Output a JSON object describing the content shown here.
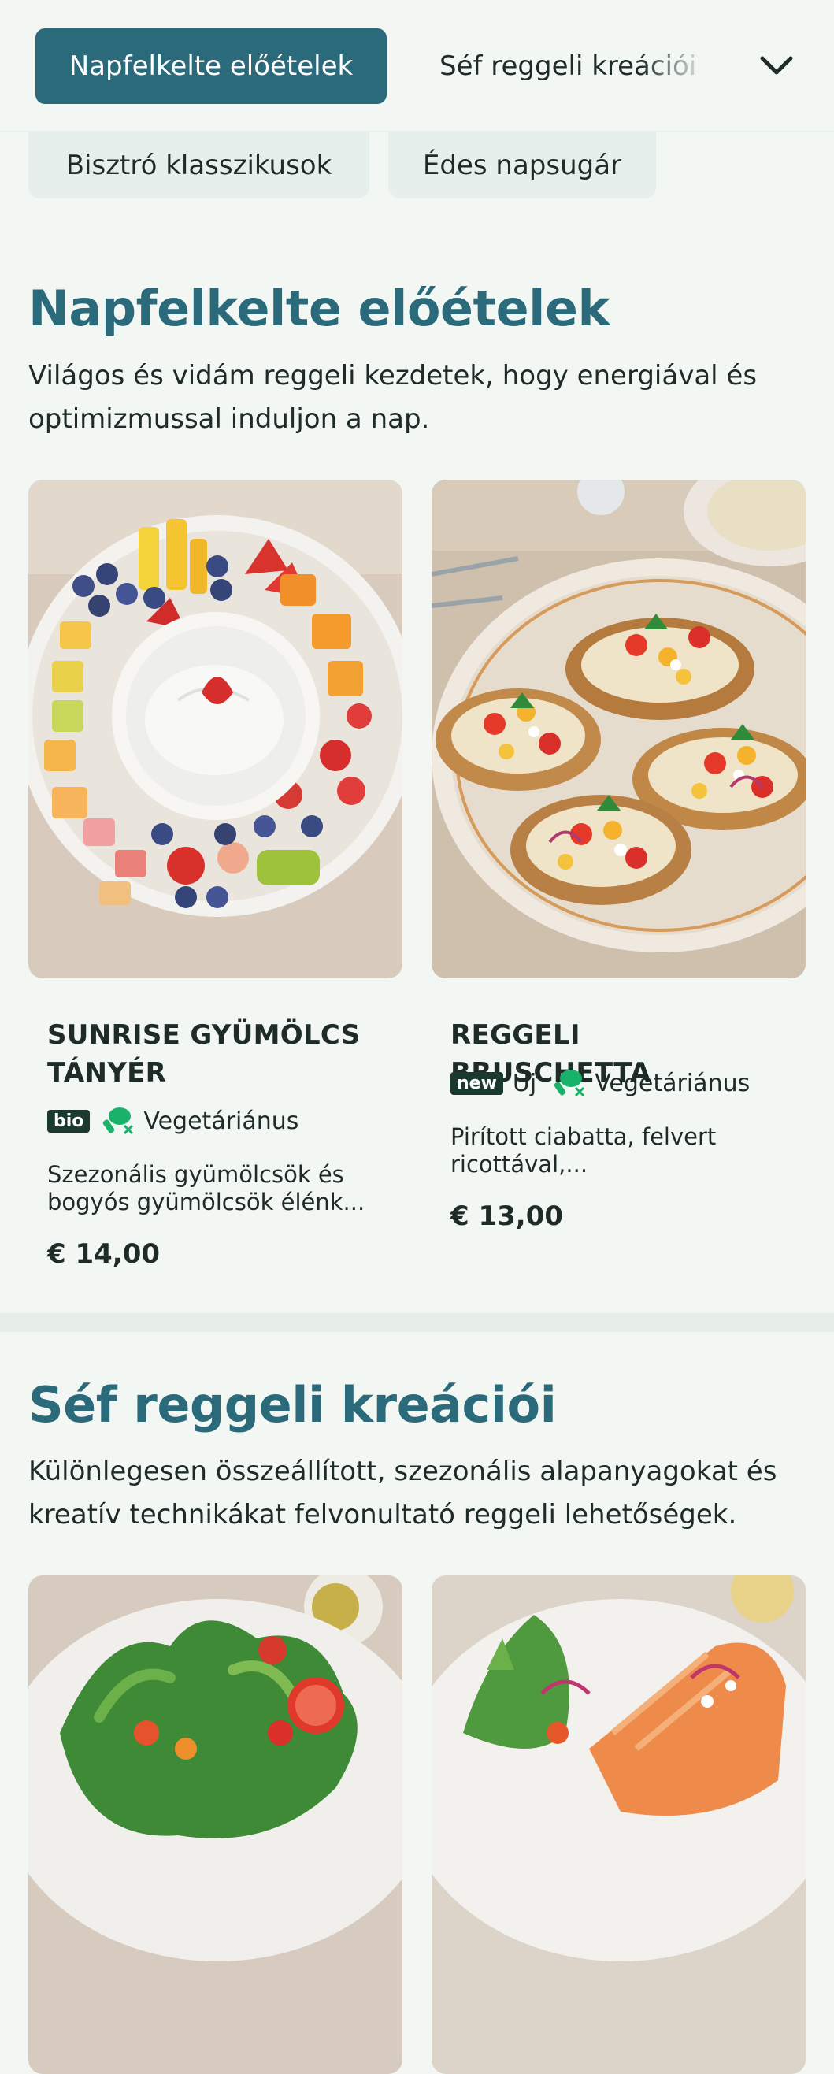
{
  "tabs": {
    "active": "Napfelkelte előételek",
    "second": "Séf reggeli kreációi",
    "row2": [
      "Bisztró klasszikusok",
      "Édes napsugár"
    ]
  },
  "sections": [
    {
      "title": "Napfelkelte előételek",
      "description": "Világos és vidám reggeli kezdetek, hogy energiával és optimizmussal induljon a nap.",
      "items": [
        {
          "title": "SUNRISE GYÜMÖLCS TÁNYÉR",
          "badge": "bio",
          "tag_text": "",
          "veg_label": "Vegetáriánus",
          "description": "Szezonális gyümölcsök és bogyós gyümölcsök élénk...",
          "price": "€ 14,00"
        },
        {
          "title": "REGGELI BRUSCHETTA",
          "badge": "new",
          "tag_text": "Új",
          "veg_label": "Vegetáriánus",
          "description": "Pirított ciabatta, felvert ricottával,...",
          "price": "€ 13,00"
        }
      ]
    },
    {
      "title": "Séf reggeli kreációi",
      "description": "Különlegesen összeállított, szezonális alapanyagokat és kreatív technikákat felvonultató reggeli lehetőségek."
    }
  ],
  "icons": {
    "dropdown": "chevron-down-icon",
    "vegetarian": "vegetarian-drumstick-crossed-icon"
  },
  "colors": {
    "accent": "#2a6a7a",
    "background": "#f2f7f3",
    "badge": "#1b3a2f",
    "veg_icon": "#19b26b"
  }
}
